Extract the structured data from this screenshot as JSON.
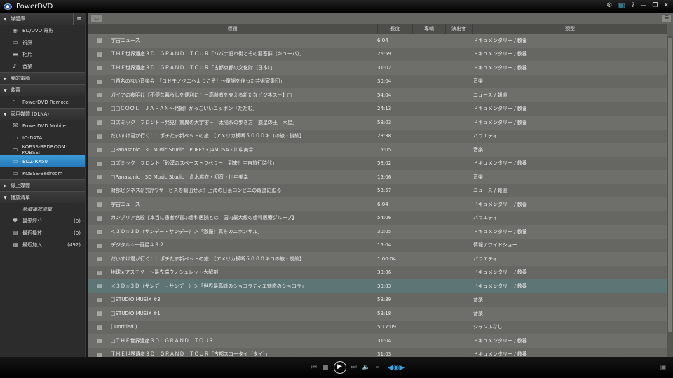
{
  "app": {
    "title": "PowerDVD"
  },
  "window": {
    "icons": [
      "settings-icon",
      "tv-icon",
      "help-icon",
      "minimize-icon",
      "restore-icon",
      "close-icon"
    ],
    "glyphs": [
      "⚙",
      "📺",
      "?",
      "—",
      "❐",
      "✕"
    ]
  },
  "sidebar": {
    "sections": [
      {
        "label": "媒體庫",
        "expanded": true,
        "items": [
          {
            "label": "BD/DVD 電影",
            "icon": "disc-icon",
            "glyph": "◉"
          },
          {
            "label": "視訊",
            "icon": "video-icon",
            "glyph": "▭"
          },
          {
            "label": "相片",
            "icon": "photo-icon",
            "glyph": "▬"
          },
          {
            "label": "音樂",
            "icon": "music-icon",
            "glyph": "♪"
          }
        ]
      },
      {
        "label": "我的電腦",
        "expanded": false,
        "items": []
      },
      {
        "label": "裝置",
        "expanded": true,
        "items": [
          {
            "label": "PowerDVD Remote",
            "icon": "remote-icon",
            "glyph": "▯"
          }
        ]
      },
      {
        "label": "家用媒體 (DLNA)",
        "expanded": true,
        "items": [
          {
            "label": "PowerDVD Mobile",
            "icon": "mobile-icon",
            "glyph": "⌘"
          },
          {
            "label": "IO-DATA",
            "icon": "monitor-icon",
            "glyph": "▭"
          },
          {
            "label": "KOBSS-BEDROOM: KOBSS:",
            "icon": "monitor-icon",
            "glyph": "▭"
          },
          {
            "label": "BDZ-RX50",
            "icon": "monitor-icon",
            "glyph": "▭",
            "selected": true
          },
          {
            "label": "KOBSS-Bedroom",
            "icon": "monitor-icon",
            "glyph": "▭"
          }
        ]
      },
      {
        "label": "線上媒體",
        "expanded": false,
        "items": []
      },
      {
        "label": "播放清單",
        "expanded": true,
        "items": [
          {
            "label": "新增播放清單",
            "icon": "plus-icon",
            "glyph": "+",
            "new": true
          },
          {
            "label": "最愛評分",
            "icon": "heart-icon",
            "glyph": "♥",
            "count": "(0)"
          },
          {
            "label": "最近播放",
            "icon": "recent-icon",
            "glyph": "▤",
            "count": "(0)"
          },
          {
            "label": "最近加入",
            "icon": "added-icon",
            "glyph": "▦",
            "count": "(492)"
          }
        ]
      }
    ]
  },
  "table": {
    "columns": [
      "標題",
      "長度",
      "專輯",
      "演出者",
      "類型"
    ],
    "rows": [
      [
        "宇宙ニュース",
        "6:04",
        "ドキュメンタリー / 教養"
      ],
      [
        "ＴＨＥ世界遺産３Ｄ　ＧＲＡＮＤ　ＴＯＵＲ「ハバナ旧市街とその要塞群（キューバ）」",
        "26:59",
        "ドキュメンタリー / 教養"
      ],
      [
        "ＴＨＥ世界遺産３Ｄ　ＧＲＡＮＤ　ＴＯＵＲ「古都京都の文化財（日本）」",
        "31:02",
        "ドキュメンタリー / 教養"
      ],
      [
        "□題名のない音楽会　「コドモノクニへようこそ！～童謡を作った芸術家集団」",
        "30:04",
        "音楽"
      ],
      [
        "ガイアの夜明け【不便な暮らしを便利に！－高齢者を支える新たなビジネス－】□",
        "54:04",
        "ニュース / 報道"
      ],
      [
        "□□ＣＯＯＬ　ＪＡＰＡＮ～発掘！かっこいいニッポン「たたむ」",
        "24:13",
        "ドキュメンタリー / 教養"
      ],
      [
        "コズミック　フロント－発見！驚異の大宇宙－「太陽系の歩き方　惑星の王　木星」",
        "58:03",
        "ドキュメンタリー / 教養"
      ],
      [
        "だいすけ君が行く！！ポチたま新ペットの旅　【アメリカ横断５０００キロの旅・後編】",
        "28:38",
        "バラエティ"
      ],
      [
        "□Panasonic　3D Music Studio　PUFFY・JAMOSA・川中美幸",
        "15:05",
        "音楽"
      ],
      [
        "コズミック　フロント「砂漠のスペーストラベラー　到来！宇宙旅行時代」",
        "58:02",
        "ドキュメンタリー / 教養"
      ],
      [
        "□Panasonic　3D Music Studio　倉木麻衣・初音・川中美幸",
        "15:06",
        "音楽"
      ],
      [
        "財部ビジネス研究所▽サービスを輸出せよ！上海の日系コンビニの躍進に迫る",
        "53:57",
        "ニュース / 報道"
      ],
      [
        "宇宙ニュース",
        "6:04",
        "ドキュメンタリー / 教養"
      ],
      [
        "カンブリア宮殿【本当に患者が喜ぶ歯科医院とは　国内最大級の歯科医療グループ】",
        "54:06",
        "バラエティ"
      ],
      [
        "＜３Ｄ☆３Ｄ（サンデー・サンデー）＞「激撮！真冬のニホンザル」",
        "30:05",
        "ドキュメンタリー / 教養"
      ],
      [
        "デジタル☆一番星＃９２",
        "15:04",
        "情報 / ワイドショー"
      ],
      [
        "だいすけ君が行く！！ポチたま新ペットの旅　【アメリカ横断５０００キロの旅・前編】",
        "1:00:04",
        "バラエティ"
      ],
      [
        "地球★アステク　～最先端ウォシュレット大解剖",
        "30:06",
        "ドキュメンタリー / 教養"
      ],
      [
        "＜３Ｄ☆３Ｄ（サンデー・サンデー）＞「世界最高峰のショコラティエ魅惑のショコラ」",
        "30:03",
        "ドキュメンタリー / 教養"
      ],
      [
        "□STUDIO MUSIX #3",
        "59:39",
        "音楽"
      ],
      [
        "□STUDIO MUSIX #1",
        "59:18",
        "音楽"
      ],
      [
        "( Untitled )",
        "5:17:09",
        "ジャンルなし"
      ],
      [
        "□ＴＨＥ世界遺産３Ｄ　ＧＲＡＮＤ　ＴＯＵＲ",
        "31:04",
        "ドキュメンタリー / 教養"
      ],
      [
        "ＴＨＥ世界遺産３Ｄ　ＧＲＡＮＤ　ＴＯＵＲ「古都スコータイ（タイ）」",
        "31:03",
        "ドキュメンタリー / 教養"
      ]
    ],
    "selected_row": 18
  },
  "player": {
    "accent": "#3aa0e0",
    "selection": "#2577b8"
  }
}
